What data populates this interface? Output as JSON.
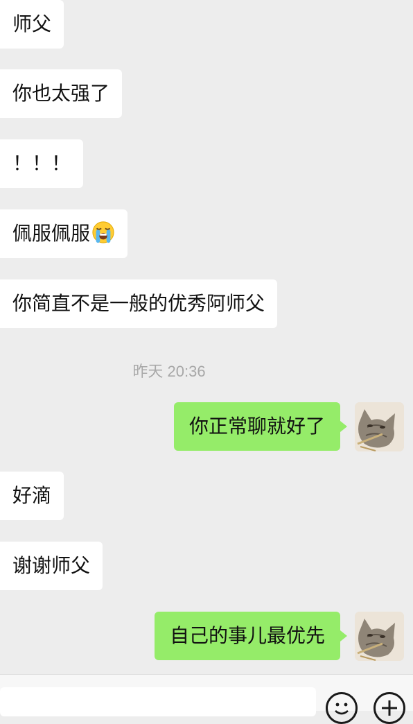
{
  "messages": [
    {
      "text": "师父"
    },
    {
      "text": "你也太强了"
    },
    {
      "text": "！！！"
    },
    {
      "text": "佩服佩服"
    },
    {
      "text": "你简直不是一般的优秀阿师父"
    },
    {
      "text": "你正常聊就好了"
    },
    {
      "text": "好滴"
    },
    {
      "text": "谢谢师父"
    },
    {
      "text": "自己的事儿最优先"
    }
  ],
  "timestamp": "昨天 20:36",
  "icons": {
    "emoji_in_message": "loudly-crying-face",
    "self_avatar": "cat-photo-avatar",
    "input_bar_left": "emoji-face-icon",
    "input_bar_right": "plus-circle-icon"
  },
  "colors": {
    "background": "#ededed",
    "incoming_bubble": "#ffffff",
    "outgoing_bubble": "#95ec69",
    "timestamp_text": "#a8a8a8"
  }
}
